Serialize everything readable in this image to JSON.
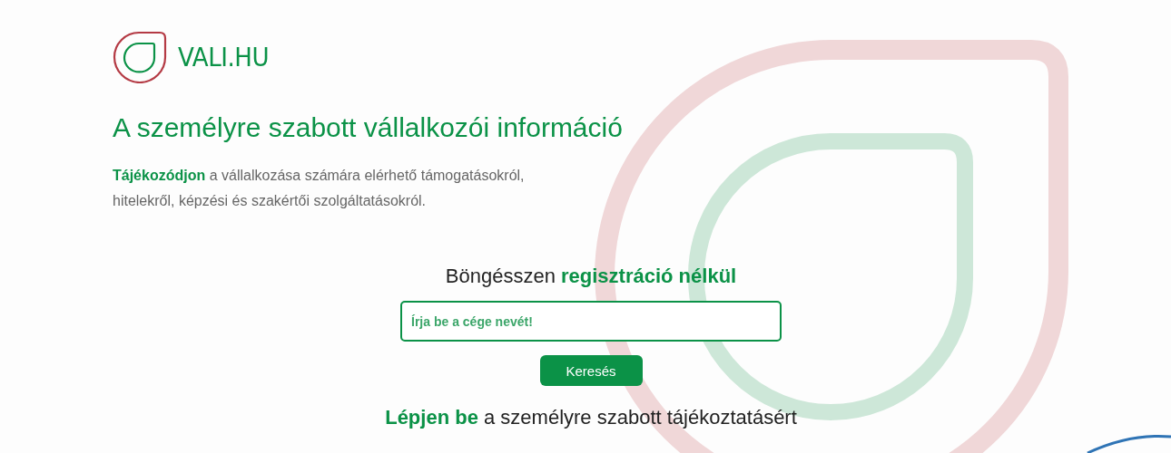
{
  "logo": {
    "text": "VALI.HU"
  },
  "hero": {
    "title": "A személyre szabott vállalkozói információ",
    "intro": "**Tájékozódjon** a vállalkozása számára elérhető támogatásokról, hitelekről, képzési és szakértői szolgáltatásokról."
  },
  "search": {
    "heading": "Böngésszen **regisztráció nélkül**",
    "placeholder": "Írja be a cége nevét!",
    "button": "Keresés"
  },
  "login": {
    "text": "**Lépjen be** a személyre szabott tájékoztatásért"
  }
}
